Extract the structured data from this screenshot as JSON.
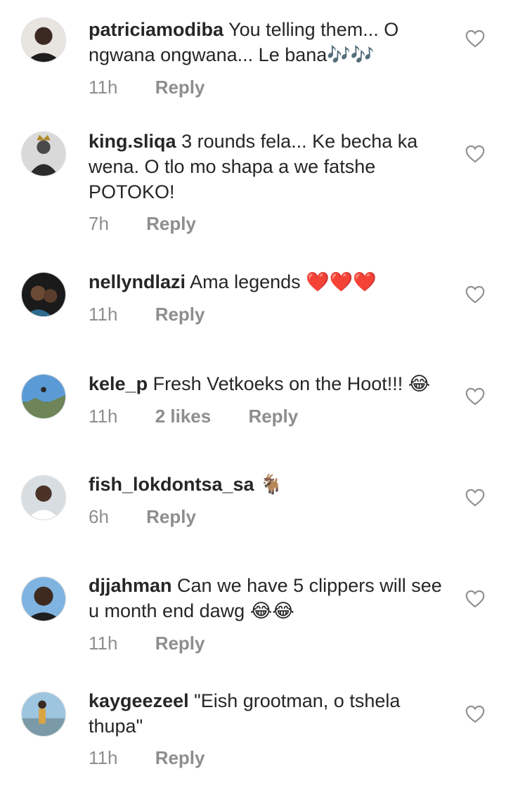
{
  "comments": [
    {
      "username": "patriciamodiba",
      "text": "You telling them... O ngwana ongwana... Le bana",
      "emoji": "🎶🎶",
      "time": "11h",
      "likes": "",
      "reply": "Reply"
    },
    {
      "username": "king.sliqa",
      "text": "3 rounds fela... Ke becha ka wena. O tlo mo shapa a we fatshe POTOKO!",
      "emoji": "",
      "time": "7h",
      "likes": "",
      "reply": "Reply"
    },
    {
      "username": "nellyndlazi",
      "text": "Ama legends",
      "emoji": "❤️❤️❤️",
      "time": "11h",
      "likes": "",
      "reply": "Reply"
    },
    {
      "username": "kele_p",
      "text": "Fresh Vetkoeks on the Hoot!!!",
      "emoji": "😂",
      "time": "11h",
      "likes": "2 likes",
      "reply": "Reply"
    },
    {
      "username": "fish_lokdontsa_sa",
      "text": "",
      "emoji": "🐐",
      "time": "6h",
      "likes": "",
      "reply": "Reply"
    },
    {
      "username": "djjahman",
      "text": "Can we have 5 clippers will see u month end dawg",
      "emoji": "😂😂",
      "time": "11h",
      "likes": "",
      "reply": "Reply"
    },
    {
      "username": "kaygeezeel",
      "text": "\"Eish grootman, o tshela thupa\"",
      "emoji": "",
      "time": "11h",
      "likes": "",
      "reply": "Reply"
    }
  ],
  "icons": {
    "like": "heart-outline-icon",
    "avatar": "profile-picture"
  },
  "colors": {
    "text": "#262626",
    "secondary": "#8e8e8e",
    "divider": "#dbdbdb"
  }
}
